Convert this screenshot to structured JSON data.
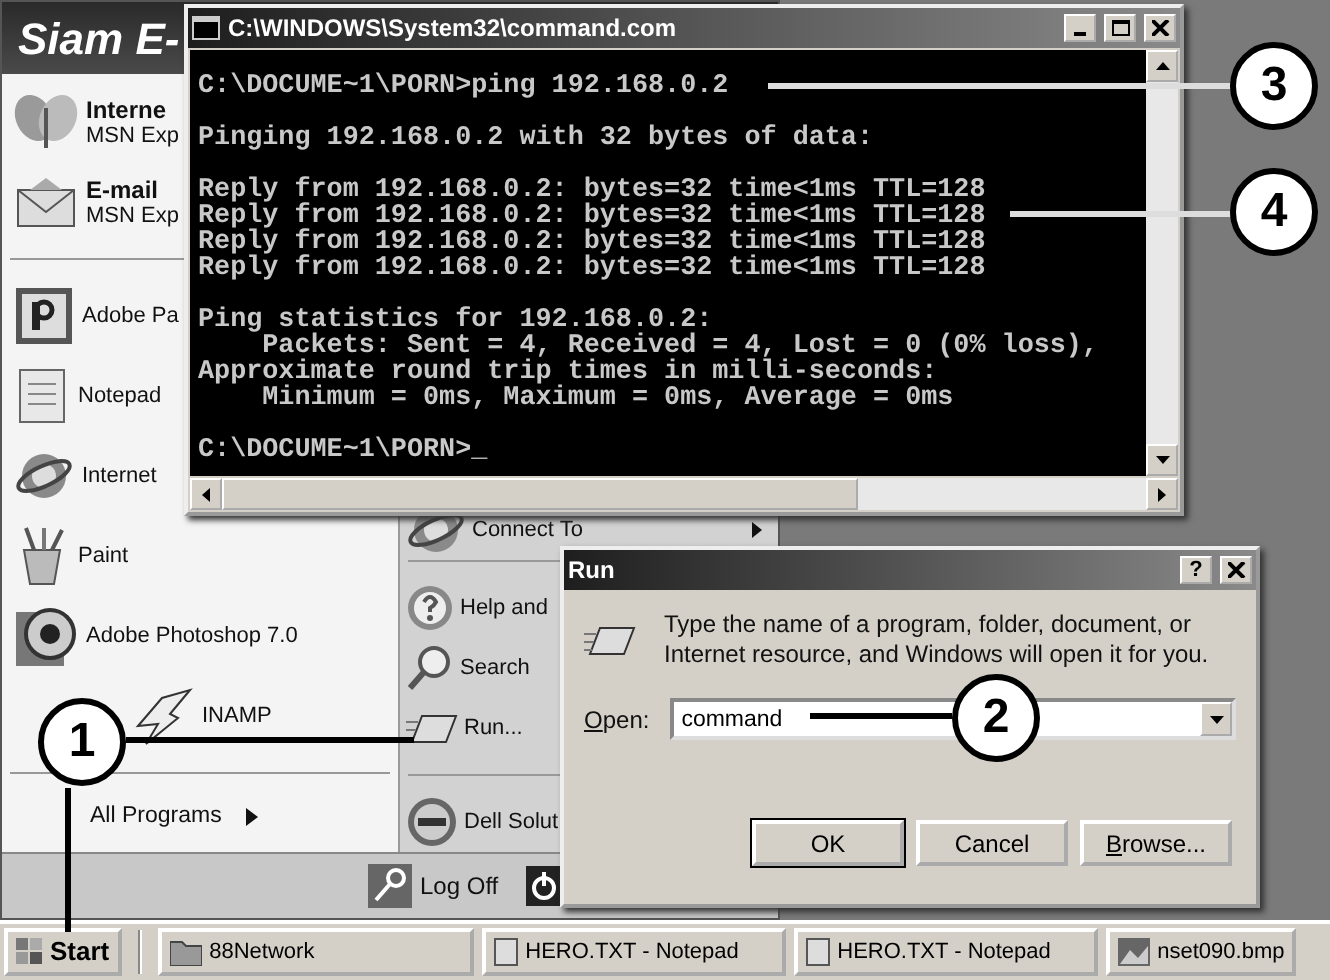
{
  "start_menu": {
    "user": "Siam E-",
    "pinned": [
      {
        "title": "Interne",
        "subtitle": "MSN Exp"
      },
      {
        "title": "E-mail",
        "subtitle": "MSN Exp"
      }
    ],
    "recent": [
      "Adobe Pa",
      "Notepad",
      "Internet",
      "Paint",
      "Adobe Photoshop 7.0",
      "INAMP"
    ],
    "all_programs": "All Programs",
    "places": [
      "Connect To",
      "Help and",
      "Search",
      "Run...",
      "Dell Solut"
    ],
    "log_off": "Log Off"
  },
  "console_window": {
    "title": "C:\\WINDOWS\\System32\\command.com",
    "blocks": [
      [
        "C:\\DOCUME~1\\PORN>ping 192.168.0.2"
      ],
      [
        "Pinging 192.168.0.2 with 32 bytes of data:"
      ],
      [
        "Reply from 192.168.0.2: bytes=32 time<1ms TTL=128",
        "Reply from 192.168.0.2: bytes=32 time<1ms TTL=128",
        "Reply from 192.168.0.2: bytes=32 time<1ms TTL=128",
        "Reply from 192.168.0.2: bytes=32 time<1ms TTL=128"
      ],
      [
        "Ping statistics for 192.168.0.2:",
        "    Packets: Sent = 4, Received = 4, Lost = 0 (0% loss),",
        "Approximate round trip times in milli-seconds:",
        "    Minimum = 0ms, Maximum = 0ms, Average = 0ms"
      ],
      [
        "C:\\DOCUME~1\\PORN>_"
      ]
    ]
  },
  "run_dialog": {
    "title": "Run",
    "help": "?",
    "message": "Type the name of a program, folder, document, or Internet resource, and Windows will open it for you.",
    "open_label": "Open:",
    "value": "command",
    "buttons": [
      {
        "label": "OK",
        "default": true
      },
      {
        "label": "Cancel",
        "default": false
      },
      {
        "label": "Browse...",
        "default": false
      }
    ]
  },
  "taskbar": {
    "start": "Start",
    "tasks": [
      "88Network",
      "HERO.TXT - Notepad",
      "HERO.TXT - Notepad",
      "nset090.bmp"
    ]
  },
  "callouts": [
    "1",
    "2",
    "3",
    "4"
  ]
}
